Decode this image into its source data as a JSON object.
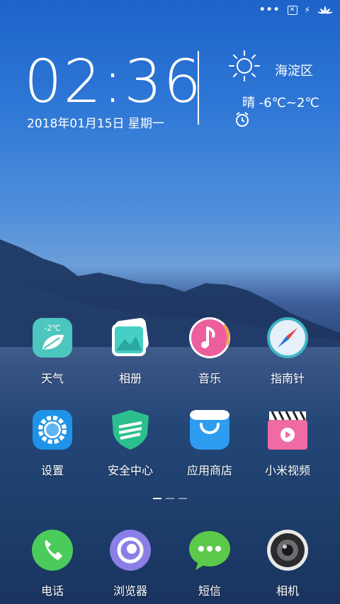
{
  "status_bar": {
    "dots": "•••"
  },
  "clock": {
    "time": "02:36",
    "date": "2018年01月15日 星期一"
  },
  "weather": {
    "district": "海淀区",
    "summary": "晴 -6℃~2℃"
  },
  "apps_row1": [
    {
      "label": "天气",
      "badge": "-2℃",
      "icon": "weather-icon"
    },
    {
      "label": "相册",
      "icon": "gallery-icon"
    },
    {
      "label": "音乐",
      "icon": "music-icon"
    },
    {
      "label": "指南针",
      "icon": "compass-icon"
    }
  ],
  "apps_row2": [
    {
      "label": "设置",
      "icon": "settings-icon"
    },
    {
      "label": "安全中心",
      "icon": "security-icon"
    },
    {
      "label": "应用商店",
      "icon": "app-store-icon"
    },
    {
      "label": "小米视频",
      "icon": "video-icon"
    }
  ],
  "dock": [
    {
      "label": "电话",
      "icon": "phone-icon"
    },
    {
      "label": "浏览器",
      "icon": "browser-icon"
    },
    {
      "label": "短信",
      "icon": "messages-icon"
    },
    {
      "label": "相机",
      "icon": "camera-icon"
    }
  ],
  "colors": {
    "weather": "#4cc6be",
    "gallery": "#45cfc6",
    "music": "#ec5f9c",
    "compass": "#3fb4c4",
    "settings": "#1f93e8",
    "security": "#2cbf8e",
    "store": "#2e9cf0",
    "video": "#f06aa4",
    "phone": "#4ccb5d",
    "browser": "#8a7fe6",
    "messages": "#5cc94a",
    "camera": "#2b2b2b"
  }
}
